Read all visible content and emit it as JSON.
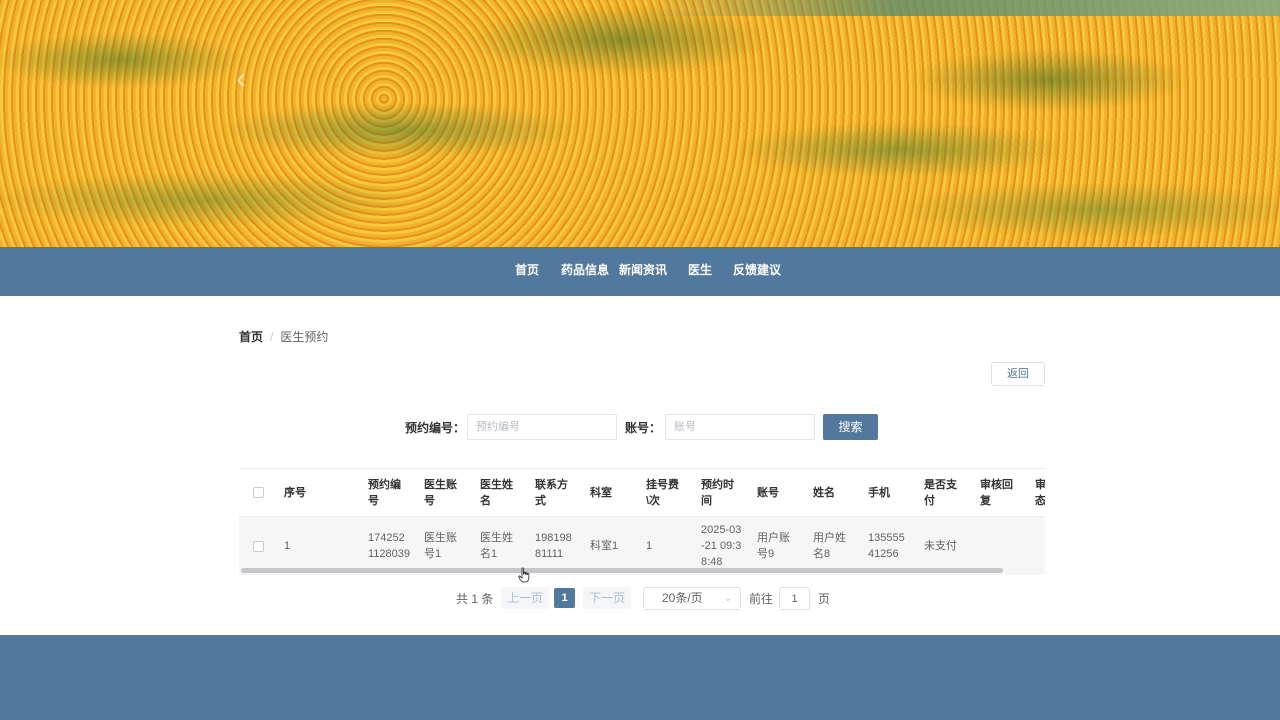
{
  "nav": {
    "items": [
      "首页",
      "药品信息",
      "新闻资讯",
      "医生",
      "反馈建议"
    ]
  },
  "breadcrumb": {
    "home": "首页",
    "separator": "/",
    "current": "医生预约"
  },
  "actions": {
    "back_label": "返回"
  },
  "search": {
    "appointment_no_label": "预约编号：",
    "appointment_no_placeholder": "预约编号",
    "account_label": "账号：",
    "account_placeholder": "账号",
    "search_label": "搜索"
  },
  "table": {
    "headers": [
      "序号",
      "预约编号",
      "医生账号",
      "医生姓名",
      "联系方式",
      "科室",
      "挂号费\\次",
      "预约时间",
      "账号",
      "姓名",
      "手机",
      "是否支付",
      "审核回复",
      "审核状态"
    ],
    "rows": [
      [
        "1",
        "1742521128039",
        "医生账号1",
        "医生姓名1",
        "19819881111",
        "科室1",
        "1",
        "2025-03-21 09:38:48",
        "用户账号9",
        "用户姓名8",
        "13555541256",
        "未支付",
        "",
        ""
      ]
    ]
  },
  "pagination": {
    "total": "共 1 条",
    "prev_label": "上一页",
    "current_page": "1",
    "next_label": "下一页",
    "page_size": "20条/页",
    "goto_label": "前往",
    "goto_value": "1",
    "page_label": "页"
  },
  "colors": {
    "primary": "#52789e",
    "banner_flowers": "#f0b63a"
  },
  "icons": {
    "banner_prev": "chevron-left-icon",
    "page_size_dropdown": "chevron-down-icon",
    "cursor": "hand-pointer-icon"
  }
}
